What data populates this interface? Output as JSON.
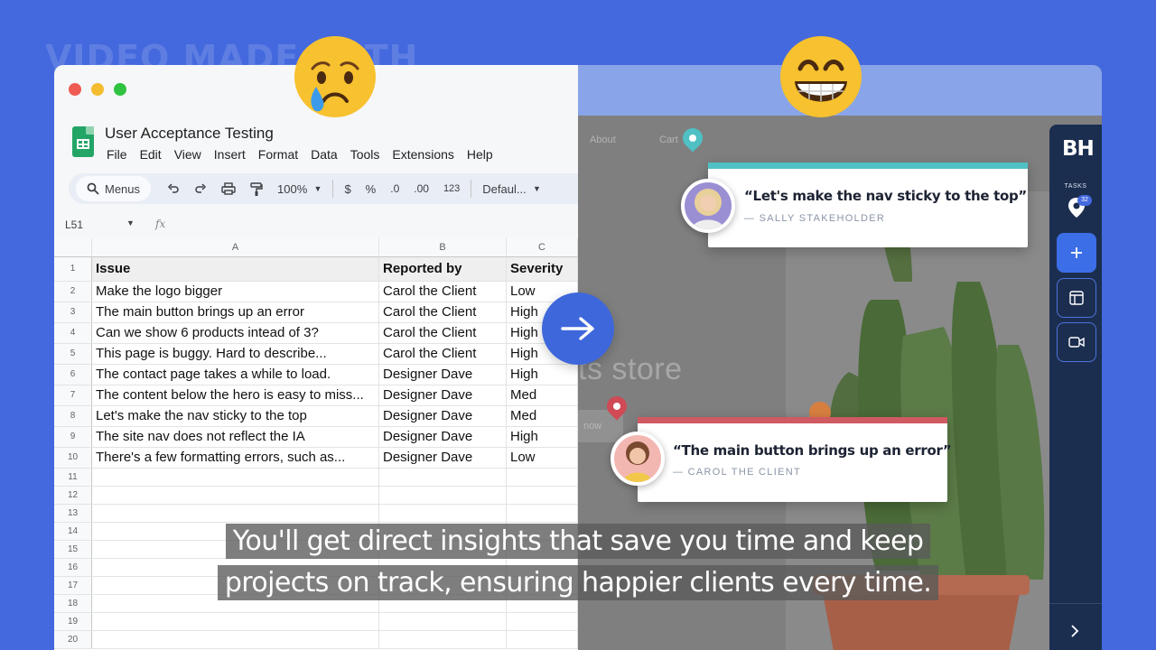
{
  "watermark": "VIDEO MADE WITH",
  "spreadsheet": {
    "title": "User Acceptance Testing",
    "menu": [
      "File",
      "Edit",
      "View",
      "Insert",
      "Format",
      "Data",
      "Tools",
      "Extensions",
      "Help"
    ],
    "toolbar": {
      "search_label": "Menus",
      "zoom": "100%",
      "currency": "$",
      "percent": "%",
      "dec_less": ".0",
      "dec_more": ".00",
      "number_format": "123",
      "font": "Defaul..."
    },
    "name_box": "L51",
    "fx_label": "fx",
    "column_letters": [
      "A",
      "B",
      "C"
    ],
    "header_row": [
      "Issue",
      "Reported by",
      "Severity"
    ],
    "rows": [
      [
        "Make the logo bigger",
        "Carol the Client",
        "Low"
      ],
      [
        "The main button brings up an error",
        "Carol the Client",
        "High"
      ],
      [
        "Can we show 6 products intead of 3?",
        "Carol the Client",
        "High"
      ],
      [
        "This page is buggy. Hard to describe...",
        "Carol the Client",
        "High"
      ],
      [
        "The contact page takes a while to load.",
        "Designer Dave",
        "High"
      ],
      [
        "The content below the hero is easy to miss...",
        "Designer Dave",
        "Med"
      ],
      [
        "Let's make the nav sticky to the top",
        "Designer Dave",
        "Med"
      ],
      [
        "The site nav does not reflect the IA",
        "Designer Dave",
        "High"
      ],
      [
        "There's a few formatting errors, such as...",
        "Designer Dave",
        "Low"
      ]
    ],
    "row_numbers": [
      "1",
      "2",
      "3",
      "4",
      "5",
      "6",
      "7",
      "8",
      "9",
      "10",
      "11",
      "12",
      "13",
      "14",
      "15",
      "16",
      "17",
      "18",
      "19",
      "20"
    ]
  },
  "website": {
    "nav": [
      "About",
      "Cart"
    ],
    "hero_text": "ts store",
    "button_text": "now"
  },
  "feedback": [
    {
      "quote": "“Let's make the nav sticky to the top”",
      "author": "— SALLY STAKEHOLDER",
      "accent": "#4fc0c4"
    },
    {
      "quote": "“The main button brings up an error”",
      "author": "— CAROL THE CLIENT",
      "accent": "#cf5a62"
    }
  ],
  "sidebar": {
    "logo": "BH",
    "tasks_label": "TASKS",
    "tasks_count": "32"
  },
  "caption": {
    "line1": "You'll get direct insights that save you time and keep",
    "line2": "projects on track, ensuring happier clients every time."
  },
  "colors": {
    "background": "#4469de",
    "panel": "#1c2e4f",
    "accent_blue": "#3c6ee8"
  }
}
